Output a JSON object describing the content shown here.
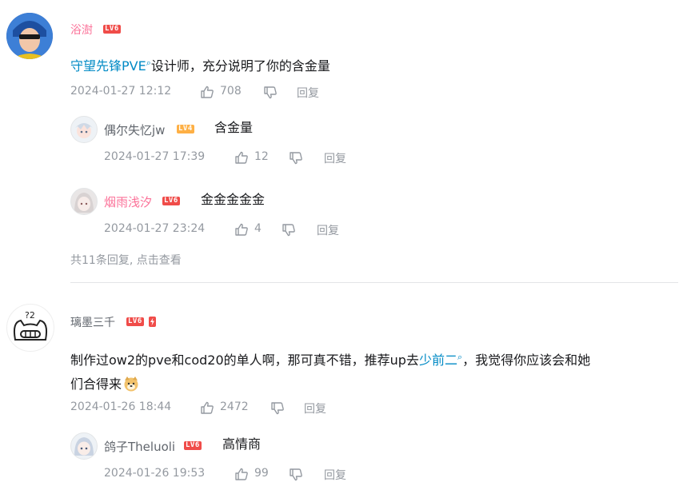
{
  "comments": [
    {
      "user": "浴澍",
      "level": "LV6",
      "content_link": "守望先锋PVE",
      "content_text": "设计师，充分说明了你的含金量",
      "time": "2024-01-27 12:12",
      "likes": "708",
      "reply_label": "回复",
      "replies": [
        {
          "user": "偶尔失忆jw",
          "level": "LV4",
          "content": "含金量",
          "time": "2024-01-27 17:39",
          "likes": "12",
          "reply_label": "回复"
        },
        {
          "user": "烟雨浅汐",
          "level": "LV6",
          "content": "金金金金金",
          "time": "2024-01-27 23:24",
          "likes": "4",
          "reply_label": "回复"
        }
      ],
      "more_replies": "共11条回复, 点击查看"
    },
    {
      "user": "璃墨三千",
      "level": "LV6",
      "content_line1a": "制作过ow2的pve和cod20的单人啊，那可真不错，推荐up去",
      "content_link": "少前二",
      "content_line1b": "，我觉得你应该会和她",
      "content_line2": "们合得来",
      "time": "2024-01-26 18:44",
      "likes": "2472",
      "reply_label": "回复",
      "replies": [
        {
          "user": "鸽子Theluoli",
          "level": "LV6",
          "content": "高情商",
          "time": "2024-01-26 19:53",
          "likes": "99",
          "reply_label": "回复"
        }
      ]
    }
  ],
  "colors": {
    "username_vip": "#fb7299",
    "link": "#008ac5",
    "meta": "#9499a0",
    "level_red": "#f04c49",
    "level_orange": "#feb045"
  }
}
